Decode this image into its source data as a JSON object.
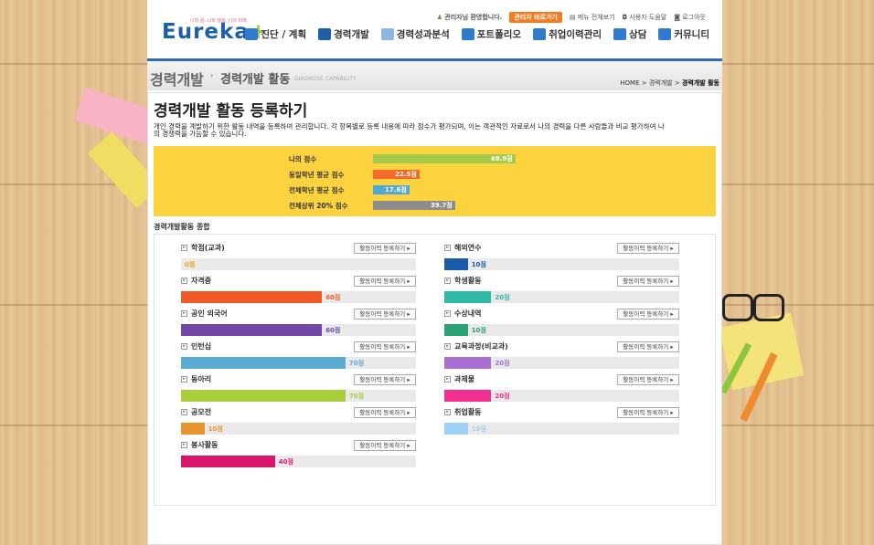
{
  "header": {
    "logo": "Eureka",
    "logo_plus": "+",
    "tagline": "나와 꿈, 나와 행복, 나의 미래",
    "admin_greeting": "관리자님 환영합니다.",
    "admin_button": "관리자 바로가기",
    "links": [
      "메뉴 전체보기",
      "사용자 도움말",
      "로그아웃"
    ],
    "nav": [
      {
        "label": "진단 / 계획",
        "color": "#3a7bd5"
      },
      {
        "label": "경력개발",
        "color": "#1f5fa8"
      },
      {
        "label": "경력성과분석",
        "color": "#4a8fd8"
      },
      {
        "label": "포트폴리오",
        "color": "#2e6fc2"
      },
      {
        "label": "취업이력관리",
        "color": "#2d6db5"
      },
      {
        "label": "상담",
        "color": "#3b83d1"
      },
      {
        "label": "커뮤니티",
        "color": "#2a74c4"
      }
    ]
  },
  "subheader": {
    "section": "경력개발",
    "page": "경력개발 활동",
    "page_eng": "DIAGNOSE CAPABILITY",
    "breadcrumb": "HOME > 경력개발 > ",
    "breadcrumb_current": "경력개발 활동"
  },
  "main": {
    "title": "경력개발 활동 등록하기",
    "description": "개인 경력을 계발하기 위한 활동 내역을 등록하여 관리합니다. 각 항목별로 등록 내용에 따라 점수가 평가되며, 이는 객관적인 자료로서 나의 경력을 다른 사람들과 비교 평가하여 나의 경쟁력을 가늠할 수 있습니다.",
    "scores": [
      {
        "label": "나의 점수",
        "value": "68.9점",
        "percent": 68.9,
        "color": "#a5c94b"
      },
      {
        "label": "동일학년 평균 점수",
        "value": "22.5점",
        "percent": 22.5,
        "color": "#f26b2b"
      },
      {
        "label": "전체학년 평균 점수",
        "value": "17.6점",
        "percent": 17.6,
        "color": "#4fa8d8"
      },
      {
        "label": "전체상위 20% 점수",
        "value": "39.7점",
        "percent": 39.7,
        "color": "#8c8c8c"
      }
    ],
    "summary_title": "경력개발활동 종합",
    "register_label": "활동이력 등록하기",
    "activities_left": [
      {
        "name": "학점(교과)",
        "value": "0점",
        "percent": 0,
        "color": "#e8a21e"
      },
      {
        "name": "자격증",
        "value": "60점",
        "percent": 60,
        "color": "#f05a28"
      },
      {
        "name": "공인 외국어",
        "value": "60점",
        "percent": 60,
        "color": "#7147a8"
      },
      {
        "name": "인턴십",
        "value": "70점",
        "percent": 70,
        "color": "#5aaad2"
      },
      {
        "name": "동아리",
        "value": "70점",
        "percent": 70,
        "color": "#a8ce3b"
      },
      {
        "name": "공모전",
        "value": "10점",
        "percent": 10,
        "color": "#e8942e"
      },
      {
        "name": "봉사활동",
        "value": "40점",
        "percent": 40,
        "color": "#d9176a"
      }
    ],
    "activities_right": [
      {
        "name": "해외연수",
        "value": "10점",
        "percent": 10,
        "color": "#1d5aa8"
      },
      {
        "name": "학생활동",
        "value": "20점",
        "percent": 20,
        "color": "#2fb9a6"
      },
      {
        "name": "수상내역",
        "value": "10점",
        "percent": 10,
        "color": "#2aa275"
      },
      {
        "name": "교육과정(비교과)",
        "value": "20점",
        "percent": 20,
        "color": "#a86fd0"
      },
      {
        "name": "과제물",
        "value": "20점",
        "percent": 20,
        "color": "#f02f8f"
      },
      {
        "name": "취업활동",
        "value": "10점",
        "percent": 10,
        "color": "#9fd0f5"
      }
    ]
  }
}
